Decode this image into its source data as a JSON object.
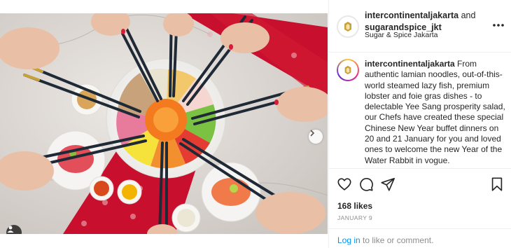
{
  "post": {
    "account_primary": "intercontinentaljakarta",
    "connector": "and",
    "account_secondary": "sugarandspice_jkt",
    "location": "Sugar & Spice Jakarta",
    "caption_author": "intercontinentaljakarta",
    "caption_text": "From authentic lamian noodles, out-of-this-world steamed lazy fish, premium lobster and foie gras dishes - to delectable Yee Sang prosperity salad, our Chefs have created these special Chinese New Year buffet dinners on 20 and 21 January for you and loved ones to welcome the new Year of the Water Rabbit in vogue.",
    "likes": "168 likes",
    "date": "JANUARY 9"
  },
  "footer": {
    "login_link": "Log in",
    "login_suffix": " to like or comment."
  },
  "icons": {
    "more": "more-options-icon",
    "like": "heart-icon",
    "comment": "comment-icon",
    "share": "share-icon",
    "save": "bookmark-icon",
    "next": "chevron-right-icon",
    "tags": "user-tag-icon"
  },
  "colors": {
    "link": "#0095f6",
    "muted": "#8e8e8e",
    "text": "#262626",
    "border": "#efefef",
    "brand_gold": "#c9a13b"
  }
}
